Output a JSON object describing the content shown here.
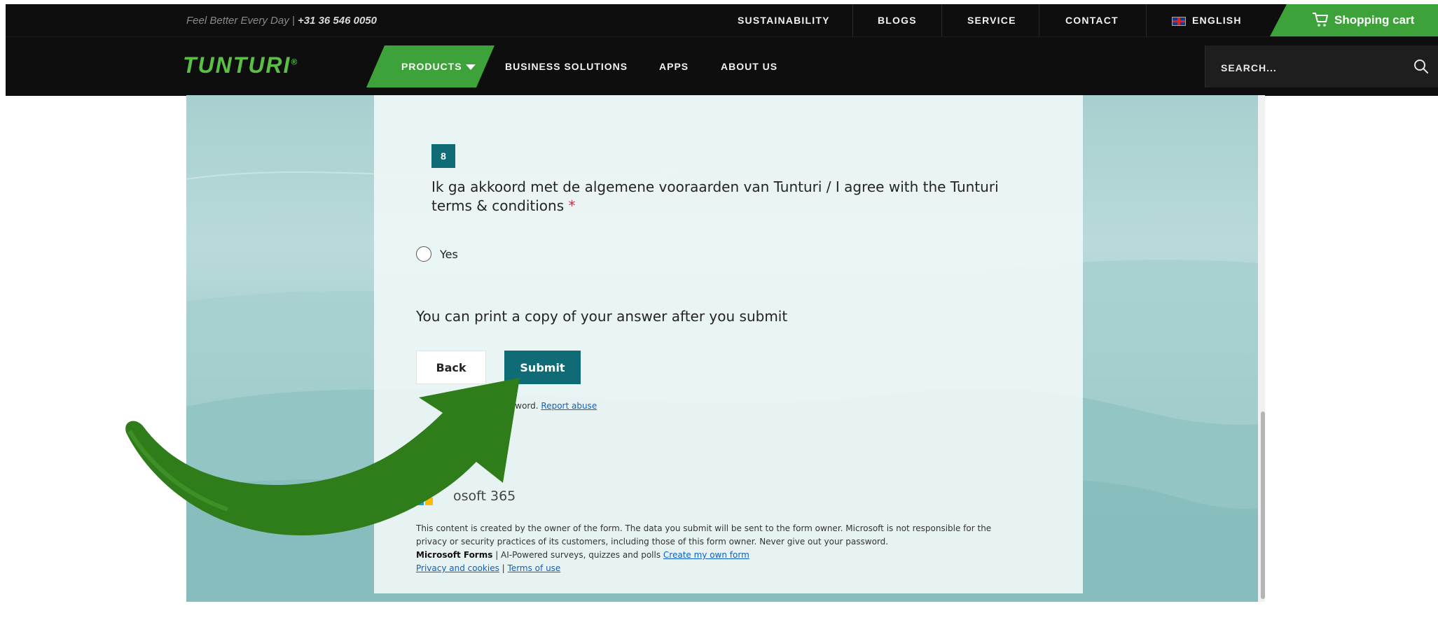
{
  "topbar": {
    "tagline_text": "Feel Better Every Day",
    "tagline_sep": " | ",
    "phone": "+31 36 546 0050",
    "links": [
      "SUSTAINABILITY",
      "BLOGS",
      "SERVICE",
      "CONTACT"
    ],
    "language": "ENGLISH",
    "cart_label": "Shopping cart"
  },
  "nav": {
    "logo": "TUNTURI",
    "logo_mark": "®",
    "products_label": "PRODUCTS",
    "links": [
      "BUSINESS SOLUTIONS",
      "APPS",
      "ABOUT US"
    ],
    "search_placeholder": "SEARCH..."
  },
  "form": {
    "question_number": "8",
    "question_text": "Ik ga akkoord met de algemene vooraarden van Tunturi / I agree with the Tunturi terms & conditions",
    "required_mark": "*",
    "option_label": "Yes",
    "print_note": "You can print a copy of your answer after you submit",
    "back_label": "Back",
    "submit_label": "Submit",
    "password_note": "sword.",
    "report_abuse": "Report abuse",
    "ms365_label": "osoft 365",
    "footer_line1": "This content is created by the owner of the form. The data you submit will be sent to the form owner. Microsoft is not responsible for the",
    "footer_line2": "privacy or security practices of its customers, including those of this form owner. Never give out your password.",
    "footer_brand": "Microsoft Forms",
    "footer_tagline": " | AI-Powered surveys, quizzes and polls ",
    "footer_create": "Create my own form",
    "footer_privacy": "Privacy and cookies",
    "footer_divider": " | ",
    "footer_terms": "Terms of use"
  },
  "colors": {
    "brand_green": "#3da23a",
    "forms_teal": "#0f6c76",
    "overlay_arrow": "#2f7d1a"
  },
  "icons": [
    "cart-icon",
    "search-icon",
    "chevron-down-icon",
    "uk-flag-icon",
    "microsoft-logo-icon",
    "arrow-annotation-icon"
  ]
}
